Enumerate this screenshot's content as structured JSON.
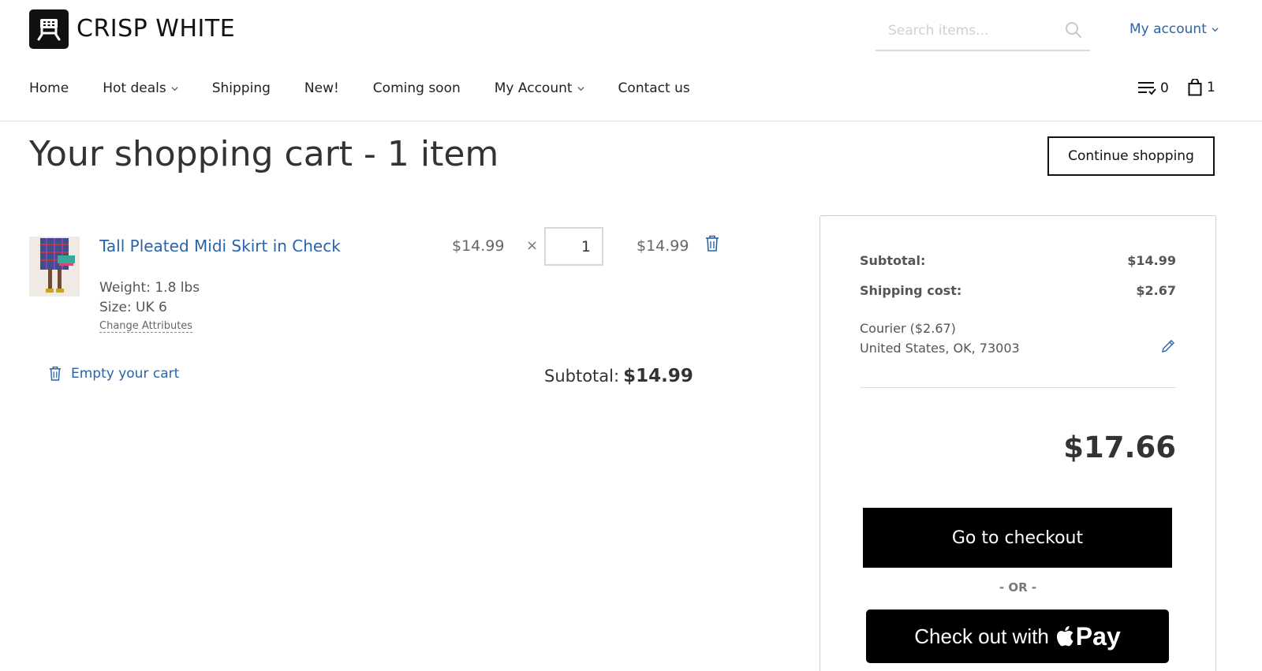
{
  "brand": {
    "name": "CRISP WHITE",
    "logo_icon": "robot-face-icon"
  },
  "header": {
    "search_placeholder": "Search items...",
    "my_account_label": "My account",
    "wishlist_count": "0",
    "cart_count": "1"
  },
  "nav": {
    "items": [
      {
        "label": "Home",
        "dropdown": false
      },
      {
        "label": "Hot deals",
        "dropdown": true
      },
      {
        "label": "Shipping",
        "dropdown": false
      },
      {
        "label": "New!",
        "dropdown": false
      },
      {
        "label": "Coming soon",
        "dropdown": false
      },
      {
        "label": "My Account",
        "dropdown": true
      },
      {
        "label": "Contact us",
        "dropdown": false
      }
    ]
  },
  "page": {
    "title": "Your shopping cart - 1 item",
    "continue_label": "Continue shopping"
  },
  "cart": {
    "item": {
      "name": "Tall Pleated Midi Skirt in Check",
      "weight": "Weight: 1.8 lbs",
      "size": "Size: UK 6",
      "change_attributes": "Change Attributes",
      "price": "$14.99",
      "times": "×",
      "quantity": "1",
      "line_total": "$14.99"
    },
    "empty_label": "Empty your cart",
    "subtotal_label": "Subtotal:",
    "subtotal_value": "$14.99"
  },
  "summary": {
    "subtotal_label": "Subtotal:",
    "subtotal_value": "$14.99",
    "shipping_label": "Shipping cost:",
    "shipping_value": "$2.67",
    "shipping_method": "Courier ($2.67)",
    "shipping_address": "United States, OK, 73003",
    "total": "$17.66",
    "checkout_label": "Go to checkout",
    "or_label": "- OR -",
    "applepay_prefix": "Check out with",
    "applepay_pay": "Pay"
  },
  "colors": {
    "link_blue": "#2a63a8",
    "button_black": "#000000"
  }
}
